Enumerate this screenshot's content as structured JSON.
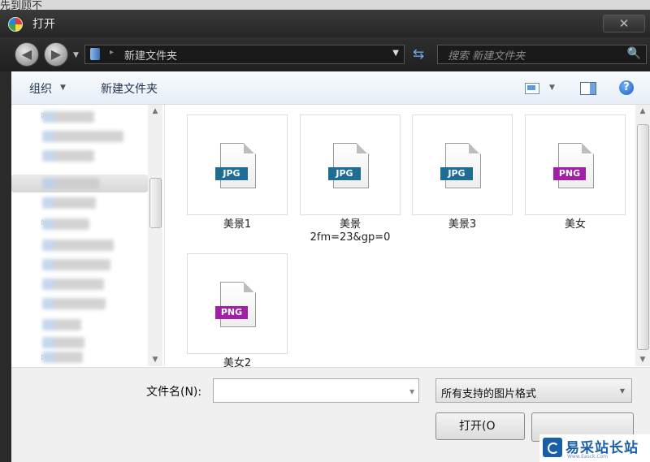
{
  "window": {
    "behind_title": "先到顾不",
    "title": "打开",
    "close_glyph": "✕"
  },
  "nav": {
    "back_glyph": "◀",
    "forward_glyph": "▶",
    "history_dropdown_glyph": "▼",
    "breadcrumb_separator": "▸",
    "address": "新建文件夹",
    "address_dropdown_glyph": "▼",
    "refresh_glyph": "⇆",
    "search_placeholder": "搜索 新建文件夹",
    "search_glyph": "🔍"
  },
  "toolbar": {
    "organize_label": "组织",
    "organize_arrow": "▼",
    "new_folder_label": "新建文件夹",
    "view_arrow": "▼",
    "help_glyph": "?"
  },
  "scroll": {
    "up_glyph": "▲",
    "down_glyph": "▼"
  },
  "files": [
    {
      "name": "美景1",
      "name2": "",
      "type": "JPG"
    },
    {
      "name": "美景",
      "name2": "2fm=23&gp=0",
      "type": "JPG"
    },
    {
      "name": "美景3",
      "name2": "",
      "type": "JPG"
    },
    {
      "name": "美女",
      "name2": "",
      "type": "PNG"
    },
    {
      "name": "美女2",
      "name2": "",
      "type": "PNG"
    }
  ],
  "bottom": {
    "filename_label": "文件名(N):",
    "filename_value": "",
    "filename_dropdown_glyph": "▼",
    "filter_value": "所有支持的图片格式",
    "filter_dropdown_glyph": "▼",
    "open_label": "打开(O"
  },
  "watermark": {
    "text": "易采站长站",
    "sub": "Www.Easck.Com"
  },
  "colors": {
    "jpg_badge": "#1f6d94",
    "png_badge": "#a21fa8",
    "accent": "#1a5ea8"
  }
}
